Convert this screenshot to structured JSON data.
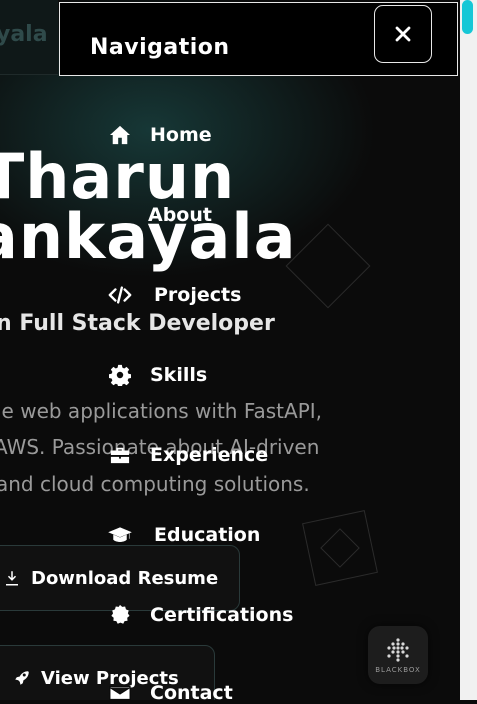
{
  "hero": {
    "name_line1": "Tharun",
    "name_line2": "ankayala",
    "role": "n Full Stack Developer",
    "description": [
      "le web applications with FastAPI,",
      "AWS. Passionate about AI-driven",
      "and cloud computing solutions."
    ],
    "resume_button": "Download Resume",
    "projects_button": "View Projects",
    "header_fragment": "yala"
  },
  "nav": {
    "title": "Navigation",
    "close_icon": "close-icon",
    "items": [
      {
        "label": "Home",
        "icon": "home-icon"
      },
      {
        "label": "About",
        "icon": "user-icon"
      },
      {
        "label": "Projects",
        "icon": "code-icon"
      },
      {
        "label": "Skills",
        "icon": "gear-icon"
      },
      {
        "label": "Experience",
        "icon": "briefcase-icon"
      },
      {
        "label": "Education",
        "icon": "graduation-cap-icon"
      },
      {
        "label": "Certifications",
        "icon": "certificate-icon"
      },
      {
        "label": "Contact",
        "icon": "envelope-icon"
      }
    ]
  },
  "badge": {
    "label": "BLACKBOX"
  },
  "colors": {
    "accent": "#16c7d6",
    "background": "#0b0b0b",
    "overlay": "#000000"
  }
}
